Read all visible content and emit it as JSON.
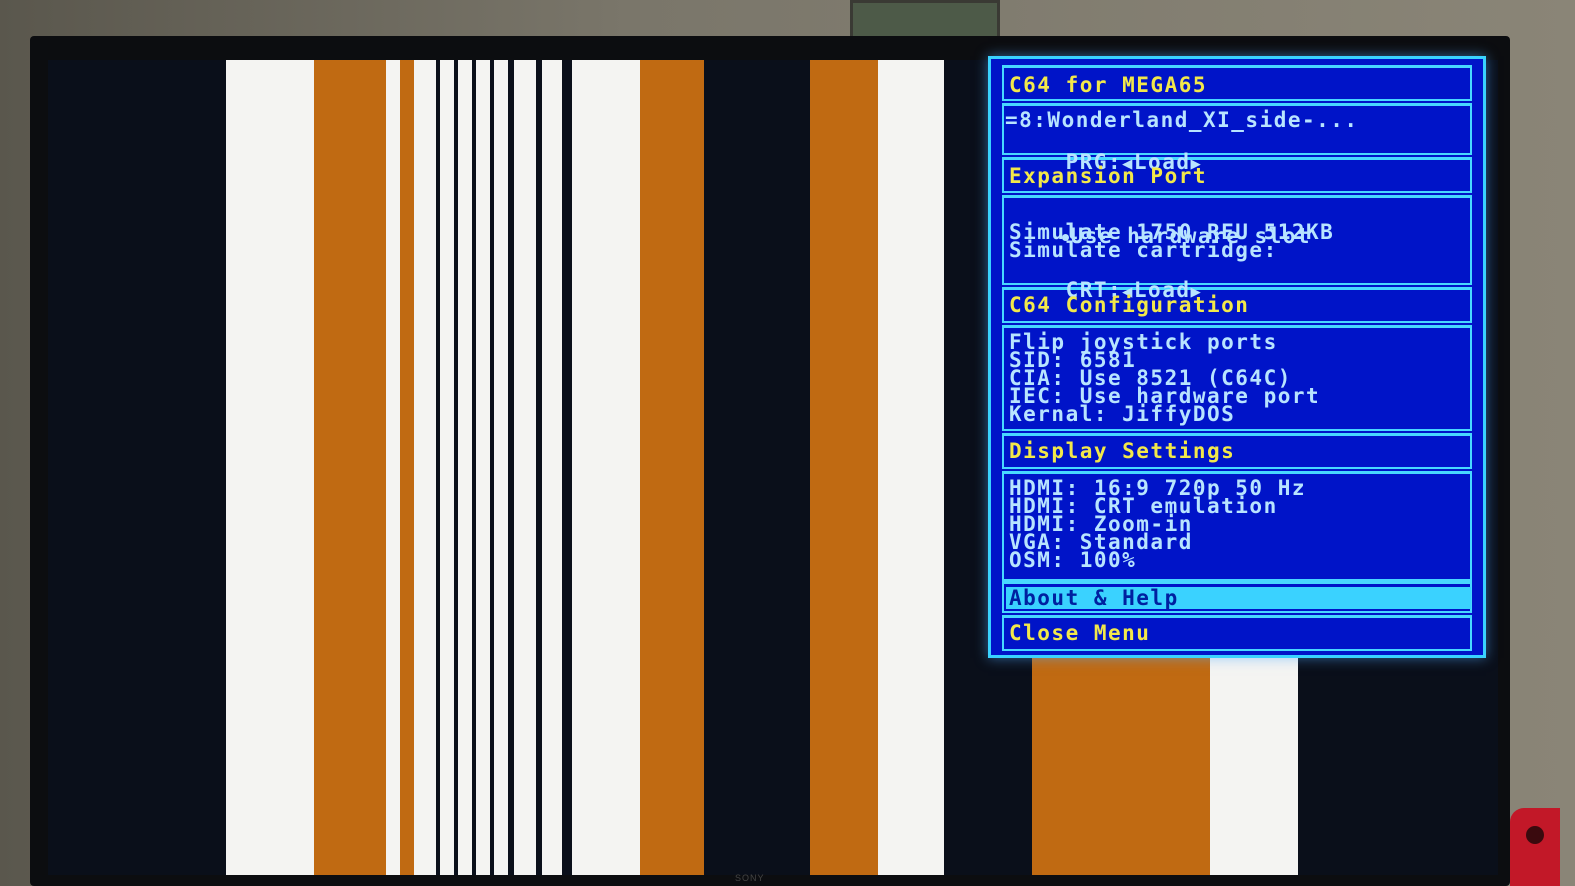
{
  "menu": {
    "title": "C64 for MEGA65",
    "file": {
      "line": "=8:Wonderland_XI_side-...",
      "prg_label": "PRG:",
      "prg_action": "Load"
    },
    "expansion": {
      "header": "Expansion Port",
      "use_hardware_slot": "Use hardware slot",
      "simulate_reu": "Simulate 1750 REU 512KB",
      "simulate_cartridge": "Simulate cartridge:",
      "crt_label": "CRT:",
      "crt_action": "Load"
    },
    "c64_config": {
      "header": "C64 Configuration",
      "items": [
        "Flip joystick ports",
        "SID: 6581",
        "CIA: Use 8521 (C64C)",
        "IEC: Use hardware port",
        "Kernal: JiffyDOS"
      ]
    },
    "display": {
      "header": "Display Settings",
      "items": [
        "HDMI: 16:9 720p 50 Hz",
        "HDMI: CRT emulation",
        "HDMI: Zoom-in",
        "VGA: Standard",
        "OSM: 100%"
      ]
    },
    "about_help": "About & Help",
    "close_menu": "Close Menu"
  },
  "tv_brand": "SONY",
  "colors": {
    "menu_bg": "#0014c8",
    "menu_border": "#3ad2ff",
    "header_text": "#f2e84a",
    "item_text": "#b8e4ff",
    "stripe_orange": "#c06a12",
    "stripe_white": "#f4f4f2"
  },
  "icons": [
    "arrow-left-icon",
    "arrow-right-icon",
    "selected-dot-icon"
  ]
}
